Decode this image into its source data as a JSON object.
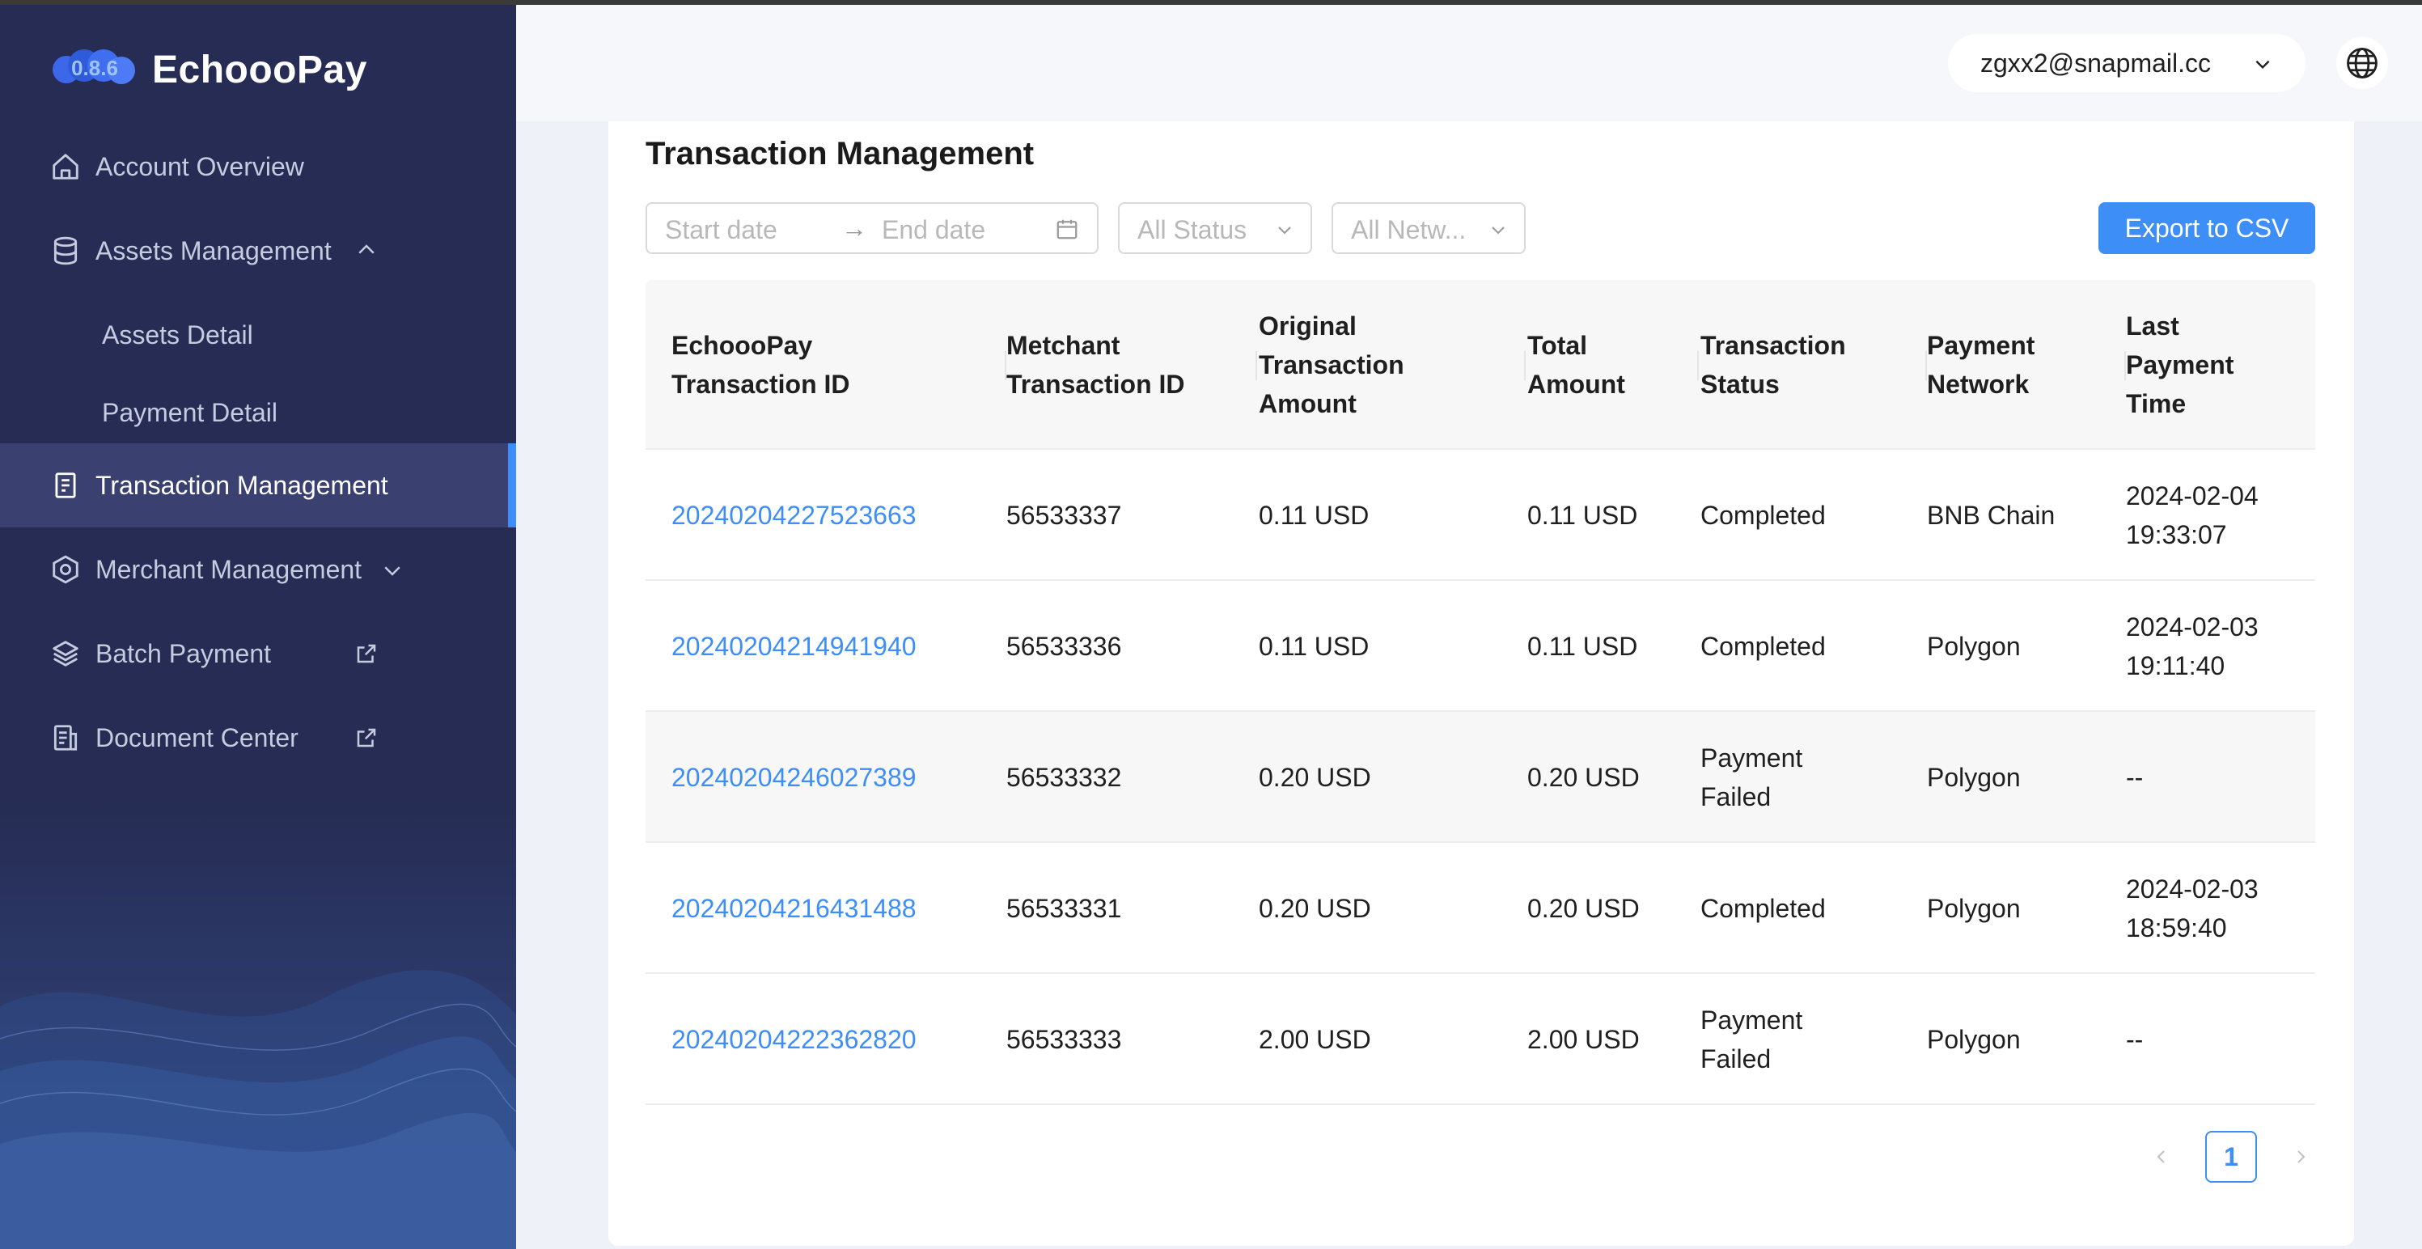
{
  "app": {
    "name": "EchoooPay"
  },
  "sidebar": {
    "items": [
      {
        "label": "Account Overview",
        "icon": "home-icon"
      },
      {
        "label": "Assets Management",
        "icon": "database-icon",
        "expanded": true
      },
      {
        "label": "Assets Detail",
        "sub": true
      },
      {
        "label": "Payment Detail",
        "sub": true
      },
      {
        "label": "Transaction Management",
        "icon": "document-icon",
        "active": true
      },
      {
        "label": "Merchant Management",
        "icon": "settings-hex-icon"
      },
      {
        "label": "Batch Payment",
        "icon": "layers-icon",
        "external": true
      },
      {
        "label": "Document Center",
        "icon": "file-list-icon",
        "external": true
      }
    ]
  },
  "header": {
    "user_email": "zgxx2@snapmail.cc",
    "language_icon": "globe-icon"
  },
  "main": {
    "title": "Transaction Management",
    "filters": {
      "start_date_placeholder": "Start date",
      "end_date_placeholder": "End date",
      "date_separator": "→",
      "status_placeholder": "All Status",
      "network_placeholder": "All Netw..."
    },
    "export_label": "Export to CSV",
    "table": {
      "columns": [
        "EchoooPay\nTransaction ID",
        "Metchant\nTransaction ID",
        "Original\nTransaction\nAmount",
        "Total\nAmount",
        "Transaction\nStatus",
        "Payment\nNetwork",
        "Last\nPayment\nTime"
      ],
      "rows": [
        [
          "20240204227523663",
          "56533337",
          "0.11 USD",
          "0.11 USD",
          "Completed",
          "BNB Chain",
          "2024-02-04\n19:33:07"
        ],
        [
          "20240204214941940",
          "56533336",
          "0.11 USD",
          "0.11 USD",
          "Completed",
          "Polygon",
          "2024-02-03\n19:11:40"
        ],
        [
          "20240204246027389",
          "56533332",
          "0.20 USD",
          "0.20 USD",
          "Payment\nFailed",
          "Polygon",
          "--"
        ],
        [
          "20240204216431488",
          "56533331",
          "0.20 USD",
          "0.20 USD",
          "Completed",
          "Polygon",
          "2024-02-03\n18:59:40"
        ],
        [
          "20240204222362820",
          "56533333",
          "2.00 USD",
          "2.00 USD",
          "Payment\nFailed",
          "Polygon",
          "--"
        ]
      ]
    },
    "pagination": {
      "current_page": "1"
    }
  },
  "colors": {
    "sidebar_bg": "#262c53",
    "accent": "#3e8ef7",
    "link": "#3e8ef7"
  }
}
